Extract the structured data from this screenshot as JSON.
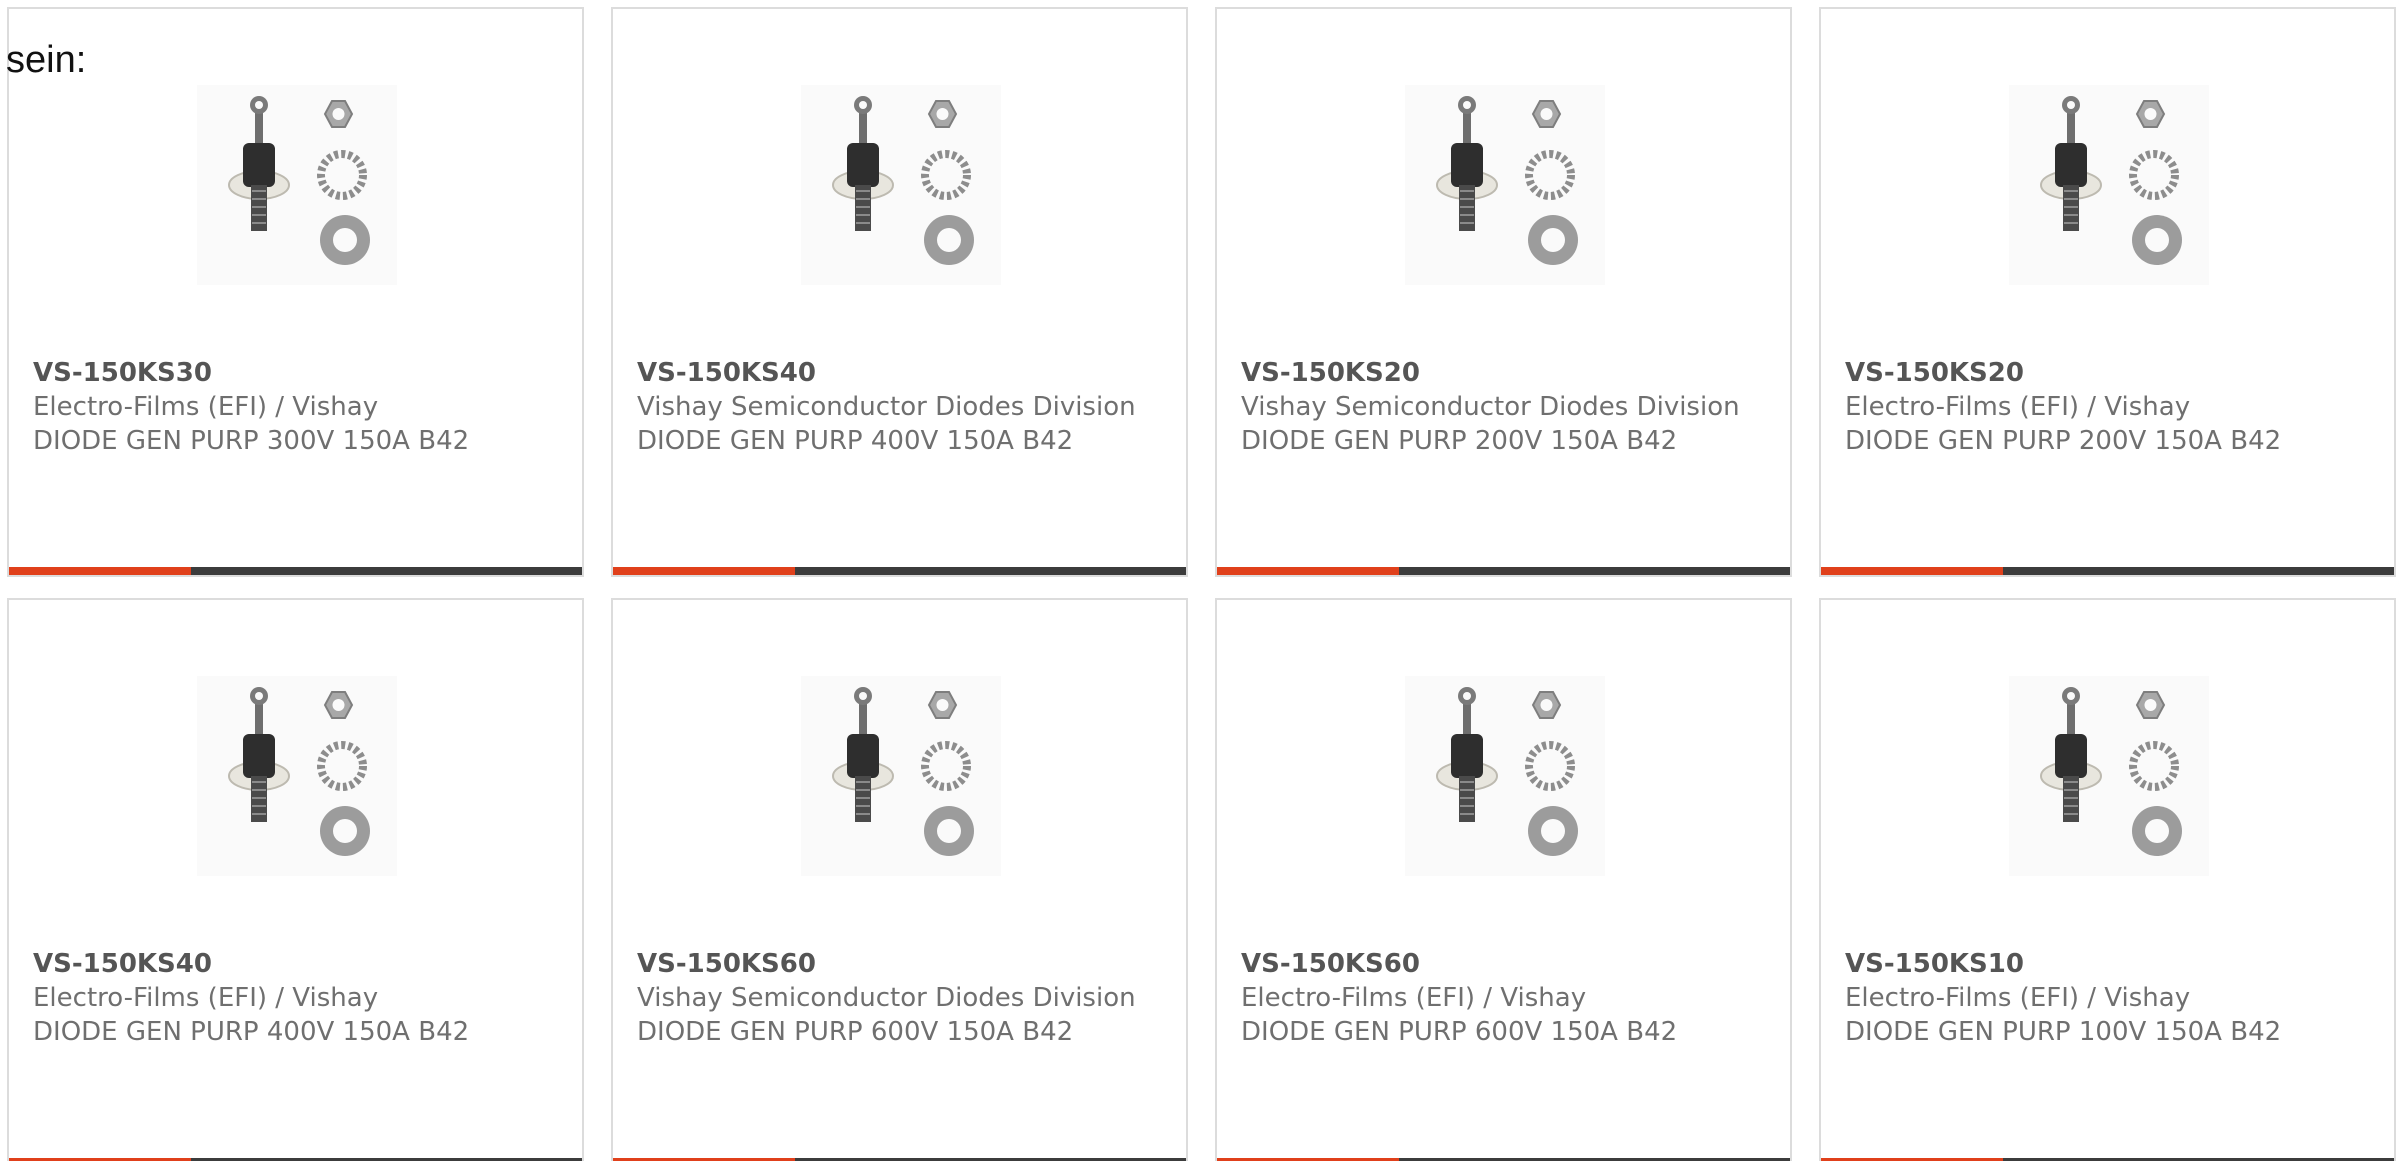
{
  "intro": {
    "text": "sein:"
  },
  "accent_color": "#e0401b",
  "bar_color": "#3c3c3c",
  "products": [
    {
      "part_number": "VS-150KS30",
      "manufacturer": "Electro-Films (EFI) / Vishay",
      "description": "DIODE GEN PURP 300V 150A B42",
      "image_icon": "diode-stud-package-icon"
    },
    {
      "part_number": "VS-150KS40",
      "manufacturer": "Vishay Semiconductor Diodes Division",
      "description": "DIODE GEN PURP 400V 150A B42",
      "image_icon": "diode-stud-package-icon"
    },
    {
      "part_number": "VS-150KS20",
      "manufacturer": "Vishay Semiconductor Diodes Division",
      "description": "DIODE GEN PURP 200V 150A B42",
      "image_icon": "diode-stud-package-icon"
    },
    {
      "part_number": "VS-150KS20",
      "manufacturer": "Electro-Films (EFI) / Vishay",
      "description": "DIODE GEN PURP 200V 150A B42",
      "image_icon": "diode-stud-package-icon"
    },
    {
      "part_number": "VS-150KS40",
      "manufacturer": "Electro-Films (EFI) / Vishay",
      "description": "DIODE GEN PURP 400V 150A B42",
      "image_icon": "diode-stud-package-icon"
    },
    {
      "part_number": "VS-150KS60",
      "manufacturer": "Vishay Semiconductor Diodes Division",
      "description": "DIODE GEN PURP 600V 150A B42",
      "image_icon": "diode-stud-package-icon"
    },
    {
      "part_number": "VS-150KS60",
      "manufacturer": "Electro-Films (EFI) / Vishay",
      "description": "DIODE GEN PURP 600V 150A B42",
      "image_icon": "diode-stud-package-icon"
    },
    {
      "part_number": "VS-150KS10",
      "manufacturer": "Electro-Films (EFI) / Vishay",
      "description": "DIODE GEN PURP 100V 150A B42",
      "image_icon": "diode-stud-package-icon"
    }
  ]
}
